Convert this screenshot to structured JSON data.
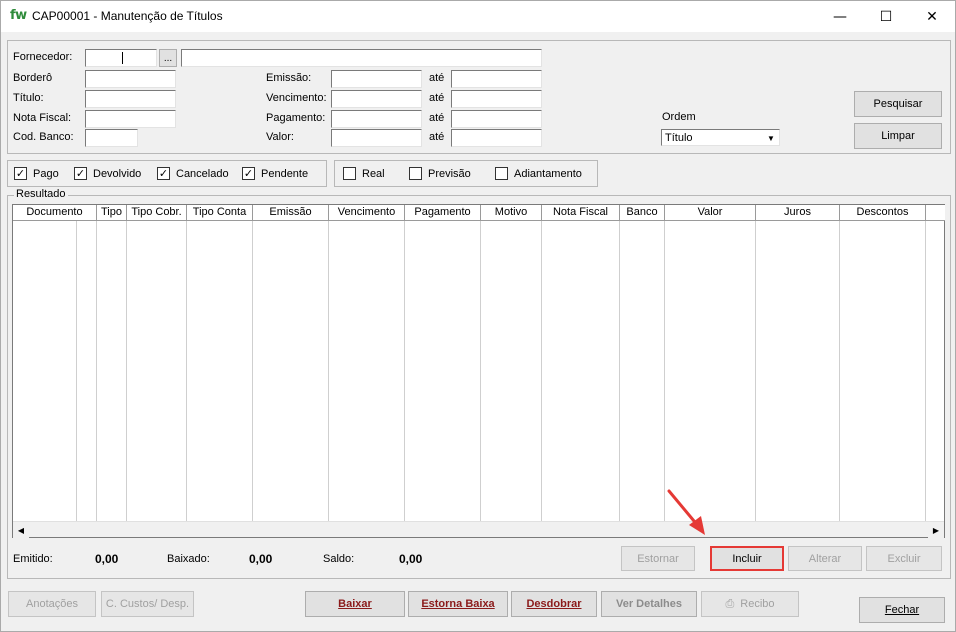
{
  "window": {
    "logo": "fw",
    "title": "CAP00001 - Manutenção de Títulos",
    "minimize": "—",
    "maximize": "☐",
    "close": "✕"
  },
  "filters": {
    "fornecedor_label": "Fornecedor:",
    "fornecedor_lookup": "...",
    "bordero_label": "Borderô",
    "titulo_label": "Título:",
    "nota_fiscal_label": "Nota Fiscal:",
    "cod_banco_label": "Cod. Banco:",
    "emissao_label": "Emissão:",
    "vencimento_label": "Vencimento:",
    "pagamento_label": "Pagamento:",
    "valor_label": "Valor:",
    "ate_label": "até",
    "ordem_label": "Ordem",
    "ordem_value": "Título",
    "pesquisar": "Pesquisar",
    "limpar": "Limpar"
  },
  "status_checks": [
    {
      "label": "Pago",
      "checked": true
    },
    {
      "label": "Devolvido",
      "checked": true
    },
    {
      "label": "Cancelado",
      "checked": true
    },
    {
      "label": "Pendente",
      "checked": true
    }
  ],
  "type_checks": [
    {
      "label": "Real",
      "checked": false
    },
    {
      "label": "Previsão",
      "checked": false
    },
    {
      "label": "Adiantamento",
      "checked": false
    }
  ],
  "results": {
    "group_label": "Resultado",
    "columns": [
      "Documento",
      "Tipo",
      "Tipo Cobr.",
      "Tipo Conta",
      "Emissão",
      "Vencimento",
      "Pagamento",
      "Motivo",
      "Nota Fiscal",
      "Banco",
      "Valor",
      "Juros",
      "Descontos"
    ]
  },
  "totals": {
    "emitido_label": "Emitido:",
    "emitido_value": "0,00",
    "baixado_label": "Baixado:",
    "baixado_value": "0,00",
    "saldo_label": "Saldo:",
    "saldo_value": "0,00"
  },
  "row_actions": {
    "estornar": "Estornar",
    "incluir": "Incluir",
    "alterar": "Alterar",
    "excluir": "Excluir"
  },
  "bottom_actions": {
    "anotacoes": "Anotações",
    "custos": "C. Custos/ Desp.",
    "baixar": "Baixar",
    "estorna_baixa": "Estorna Baixa",
    "desdobrar": "Desdobrar",
    "ver_detalhes": "Ver Detalhes",
    "recibo": "Recibo",
    "fechar": "Fechar"
  },
  "colors": {
    "highlight": "#e53935",
    "logo": "#2e8b3a"
  }
}
